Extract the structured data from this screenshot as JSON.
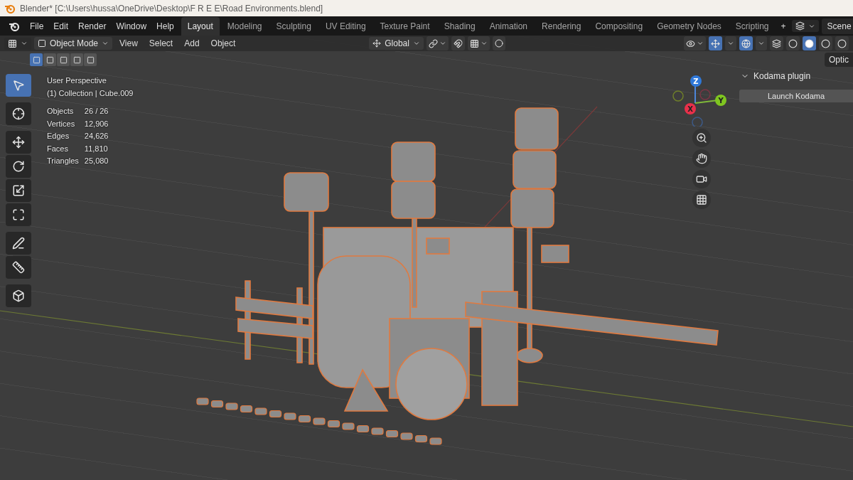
{
  "title_bar": {
    "title": "Blender* [C:\\Users\\hussa\\OneDrive\\Desktop\\F R E E\\Road Environments.blend]"
  },
  "top_bar": {
    "menus": [
      "File",
      "Edit",
      "Render",
      "Window",
      "Help"
    ],
    "workspaces": [
      {
        "label": "Layout",
        "selected": true
      },
      {
        "label": "Modeling",
        "selected": false
      },
      {
        "label": "Sculpting",
        "selected": false
      },
      {
        "label": "UV Editing",
        "selected": false
      },
      {
        "label": "Texture Paint",
        "selected": false
      },
      {
        "label": "Shading",
        "selected": false
      },
      {
        "label": "Animation",
        "selected": false
      },
      {
        "label": "Rendering",
        "selected": false
      },
      {
        "label": "Compositing",
        "selected": false
      },
      {
        "label": "Geometry Nodes",
        "selected": false
      },
      {
        "label": "Scripting",
        "selected": false
      }
    ],
    "add_tab": "+",
    "scene": "Scene"
  },
  "header": {
    "mode": "Object Mode",
    "menus": [
      "View",
      "Select",
      "Add",
      "Object"
    ],
    "orientation": "Global",
    "overlays_on": true,
    "gizmos_on": true,
    "shading_modes": [
      {
        "selected": false
      },
      {
        "selected": true
      },
      {
        "selected": false
      },
      {
        "selected": false
      }
    ],
    "select_modes": [
      {
        "selected": true
      },
      {
        "selected": false
      },
      {
        "selected": false
      },
      {
        "selected": false
      },
      {
        "selected": false
      }
    ]
  },
  "tools": [
    {
      "kind": "select",
      "selected": true
    },
    {
      "kind": "cursor",
      "selected": false
    },
    {
      "kind": "move",
      "selected": false
    },
    {
      "kind": "rotate",
      "selected": false
    },
    {
      "kind": "scale",
      "selected": false
    },
    {
      "kind": "transform",
      "selected": false
    },
    {
      "kind": "annotate",
      "selected": false
    },
    {
      "kind": "measure",
      "selected": false
    },
    {
      "kind": "add-cube",
      "selected": false
    }
  ],
  "viewport": {
    "view_name": "User Perspective",
    "collection": "(1) Collection | Cube.009",
    "stats": [
      {
        "label": "Objects",
        "value": "26 / 26"
      },
      {
        "label": "Vertices",
        "value": "12,906"
      },
      {
        "label": "Edges",
        "value": "24,626"
      },
      {
        "label": "Faces",
        "value": "11,810"
      },
      {
        "label": "Triangles",
        "value": "25,080"
      }
    ],
    "gizmo_axes": [
      "Z",
      "Y",
      "X"
    ]
  },
  "sidebar": {
    "tab": "Optic",
    "panel": {
      "title": "Kodama plugin",
      "expanded": true,
      "button": "Launch Kodama"
    }
  }
}
